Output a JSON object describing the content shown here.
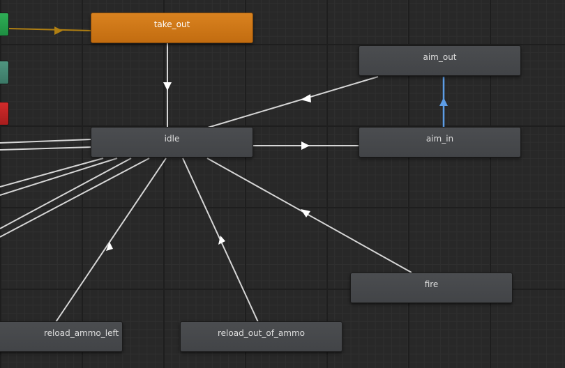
{
  "states": {
    "take_out": "take_out",
    "aim_out": "aim_out",
    "idle": "idle",
    "aim_in": "aim_in",
    "fire": "fire",
    "reload_ammo_left": "reload_ammo_left",
    "reload_out_of_ammo": "reload_out_of_ammo"
  },
  "colors": {
    "default_state": "#d9821f",
    "state_node": "#46484b",
    "transition": "#d6d6d6",
    "entry_transition": "#b07f12",
    "selected_transition": "#5d9de6",
    "entry_node": "#2fae56",
    "any_state_node": "#4f9580",
    "exit_node": "#d22b2b"
  },
  "icons": {
    "transition_arrow": "triangle-arrow-icon"
  }
}
